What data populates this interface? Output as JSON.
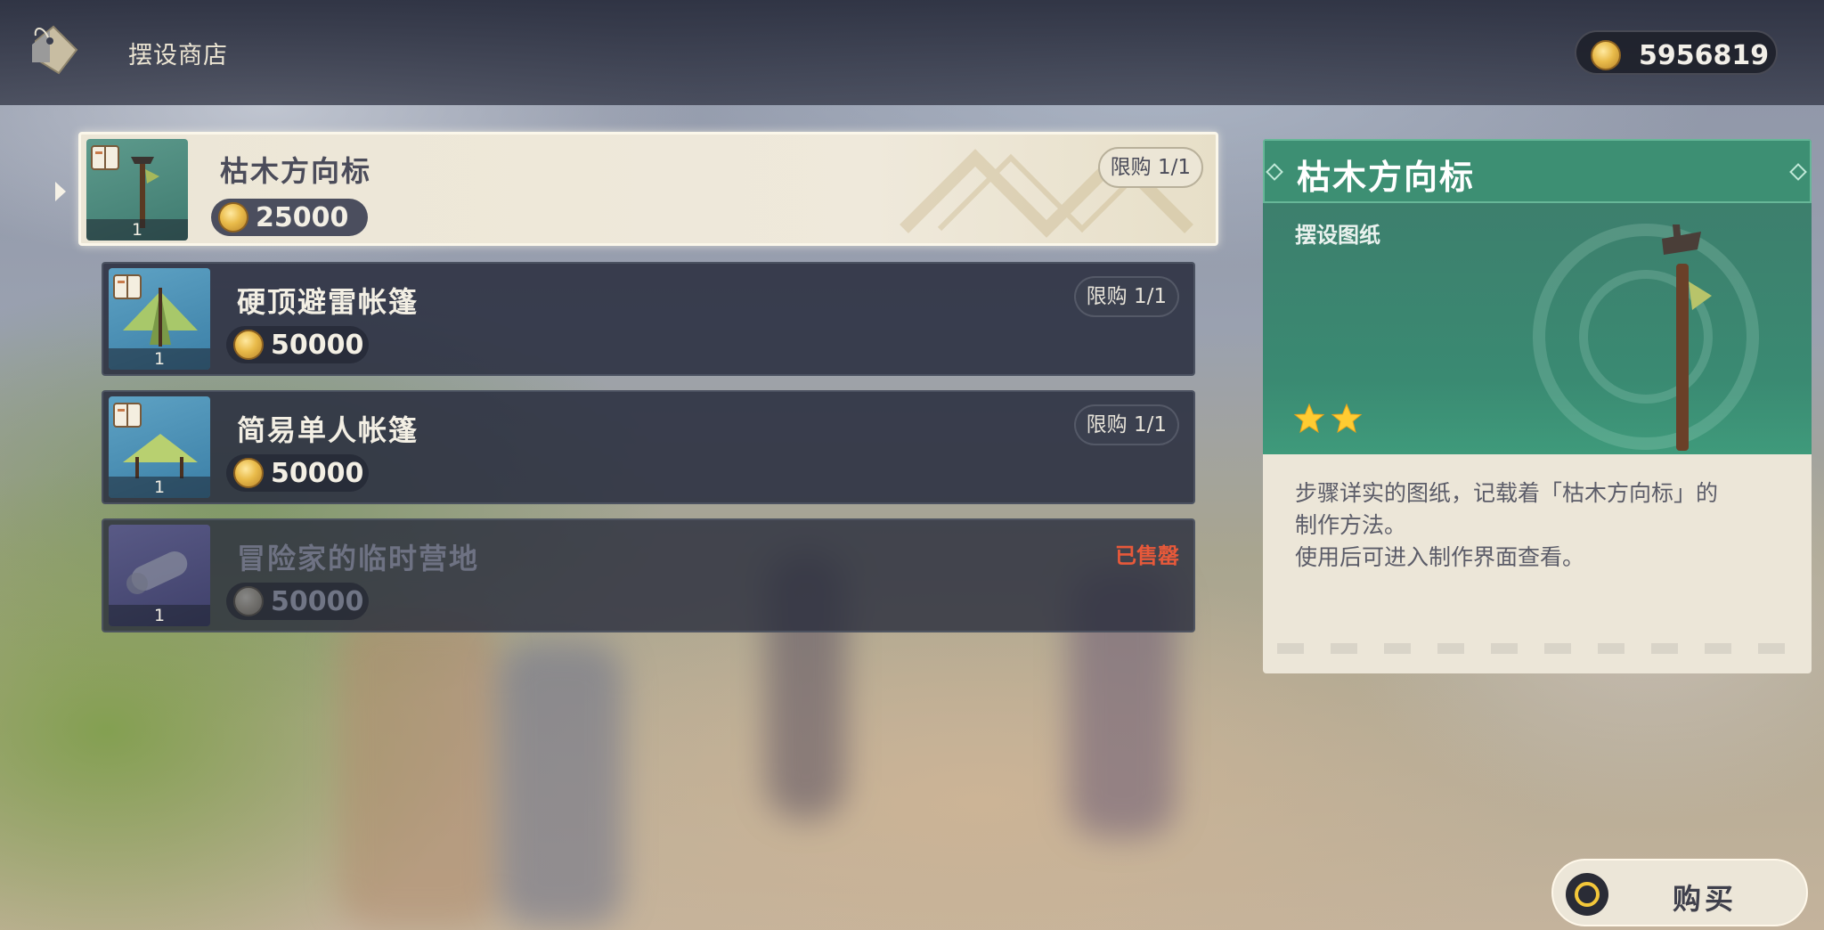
{
  "header": {
    "title": "摆设商店",
    "currency_amount": "5956819"
  },
  "items": [
    {
      "name": "枯木方向标",
      "price": "25000",
      "limit": "限购 1/1",
      "count": "1",
      "state": "selected"
    },
    {
      "name": "硬顶避雷帐篷",
      "price": "50000",
      "limit": "限购 1/1",
      "count": "1",
      "state": "available"
    },
    {
      "name": "简易单人帐篷",
      "price": "50000",
      "limit": "限购 1/1",
      "count": "1",
      "state": "available"
    },
    {
      "name": "冒险家的临时营地",
      "price": "50000",
      "status": "已售罄",
      "count": "1",
      "state": "sold_out"
    }
  ],
  "detail": {
    "title": "枯木方向标",
    "type": "摆设图纸",
    "rarity_stars": 2,
    "description_lines": [
      "步骤详实的图纸，记载着「枯木方向标」的",
      "制作方法。",
      "使用后可进入制作界面查看。"
    ]
  },
  "buy_button": {
    "label": "购买"
  },
  "colors": {
    "accent_green": "#3d8f73",
    "sold_out_red": "#e8593a",
    "panel_cream": "#ece6d8",
    "dark_panel": "#2a2f40"
  }
}
